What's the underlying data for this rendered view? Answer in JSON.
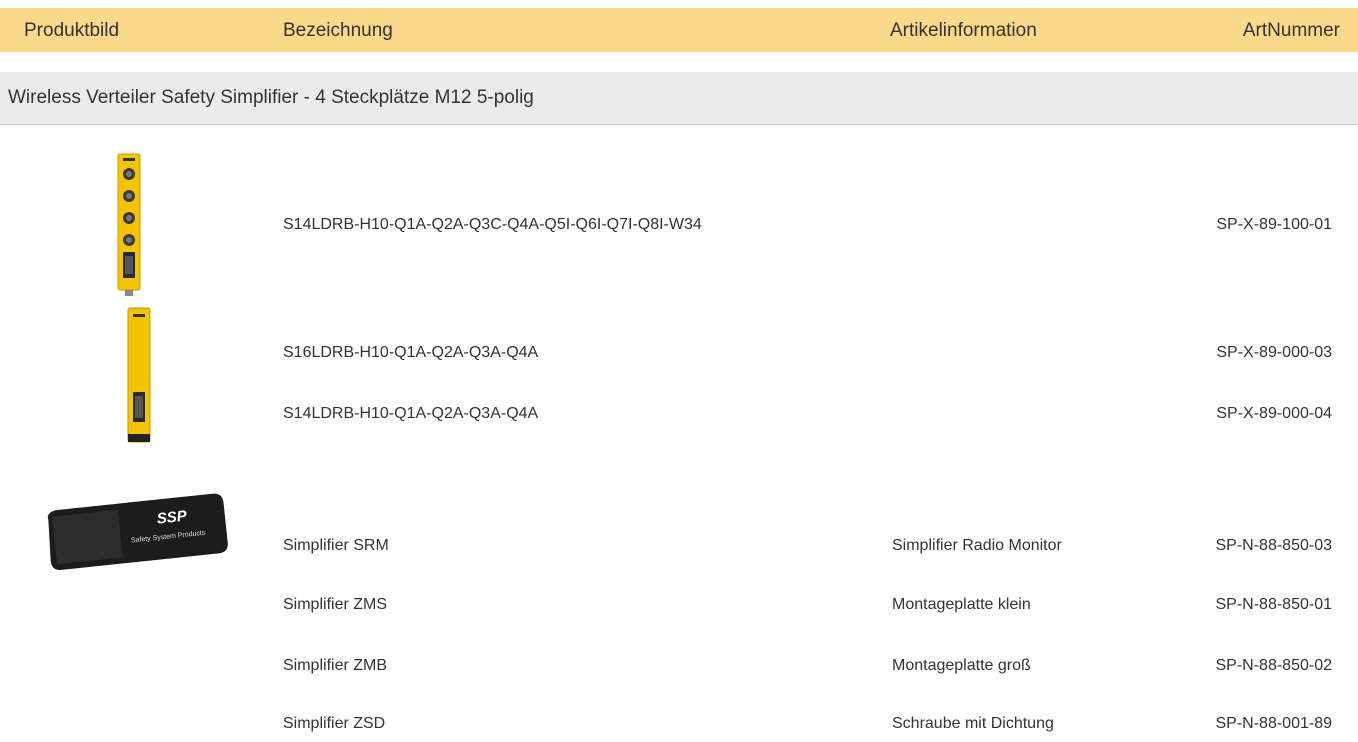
{
  "header": {
    "col_image": "Produktbild",
    "col_name": "Bezeichnung",
    "col_info": "Artikelinformation",
    "col_art": "ArtNummer"
  },
  "section": {
    "title": "Wireless Verteiler Safety Simplifier - 4 Steckplätze M12 5-polig"
  },
  "rows": [
    {
      "name": "S14LDRB-H10-Q1A-Q2A-Q3C-Q4A-Q5I-Q6I-Q7I-Q8I-W34",
      "info": "",
      "art": "SP-X-89-100-01"
    },
    {
      "name": "S16LDRB-H10-Q1A-Q2A-Q3A-Q4A",
      "info": "",
      "art": "SP-X-89-000-03"
    },
    {
      "name": "S14LDRB-H10-Q1A-Q2A-Q3A-Q4A",
      "info": "",
      "art": "SP-X-89-000-04"
    },
    {
      "name": "Simplifier SRM",
      "info": "Simplifier Radio Monitor",
      "art": "SP-N-88-850-03"
    },
    {
      "name": "Simplifier ZMS",
      "info": "Montageplatte klein",
      "art": "SP-N-88-850-01"
    },
    {
      "name": "Simplifier ZMB",
      "info": "Montageplatte groß",
      "art": "SP-N-88-850-02"
    },
    {
      "name": "Simplifier ZSD",
      "info": "Schraube mit Dichtung",
      "art": "SP-N-88-001-89"
    }
  ],
  "images": {
    "usb_brand": "SSP",
    "usb_tagline": "Safety System Products"
  },
  "colors": {
    "header_bg": "#fbd98a",
    "section_bg": "#ebebeb",
    "device_yellow": "#f5c400",
    "usb_black": "#1c1c1c"
  }
}
